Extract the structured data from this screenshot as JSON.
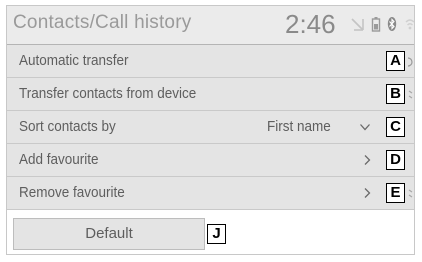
{
  "header": {
    "title": "Contacts/Call history",
    "clock": "2:46",
    "status_icons": [
      "signal-icon",
      "battery-icon",
      "bluetooth-icon",
      "wifi-icon"
    ]
  },
  "rows": [
    {
      "label": "Automatic transfer",
      "value": "",
      "control": "toggle",
      "marker": "A"
    },
    {
      "label": "Transfer contacts from device",
      "value": "",
      "control": "none",
      "marker": "B"
    },
    {
      "label": "Sort contacts by",
      "value": "First name",
      "control": "chevron-down",
      "marker": "C"
    },
    {
      "label": "Add favourite",
      "value": "",
      "control": "chevron-right",
      "marker": "D"
    },
    {
      "label": "Remove favourite",
      "value": "",
      "control": "chevron-right",
      "marker": "E"
    }
  ],
  "default_button": {
    "label": "Default",
    "marker": "J"
  },
  "colors": {
    "header_bg": "#ebebeb",
    "row_bg": "#e4e4e4",
    "text": "#5e5e5e",
    "marker_border": "#000000"
  }
}
